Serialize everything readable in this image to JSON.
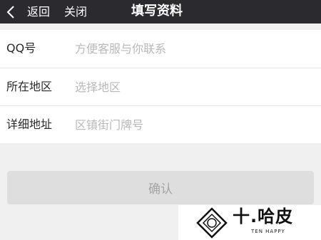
{
  "titlebar": {
    "back_label": "返回",
    "close_label": "关闭",
    "title": "填写资料"
  },
  "form": {
    "rows": [
      {
        "label": "QQ号",
        "placeholder": "方便客服与你联系",
        "value": ""
      },
      {
        "label": "所在地区",
        "placeholder": "选择地区",
        "value": ""
      },
      {
        "label": "详细地址",
        "placeholder": "区镇街门牌号",
        "value": ""
      }
    ]
  },
  "confirm_label": "确认",
  "watermark": {
    "text": "十.哈皮",
    "sub": "TEN HAPPY"
  },
  "colors": {
    "titlebar_bg": "#2b2b2f",
    "page_bg": "#f0f0f0",
    "button_bg": "#dedede",
    "placeholder": "#b8b8b8"
  }
}
